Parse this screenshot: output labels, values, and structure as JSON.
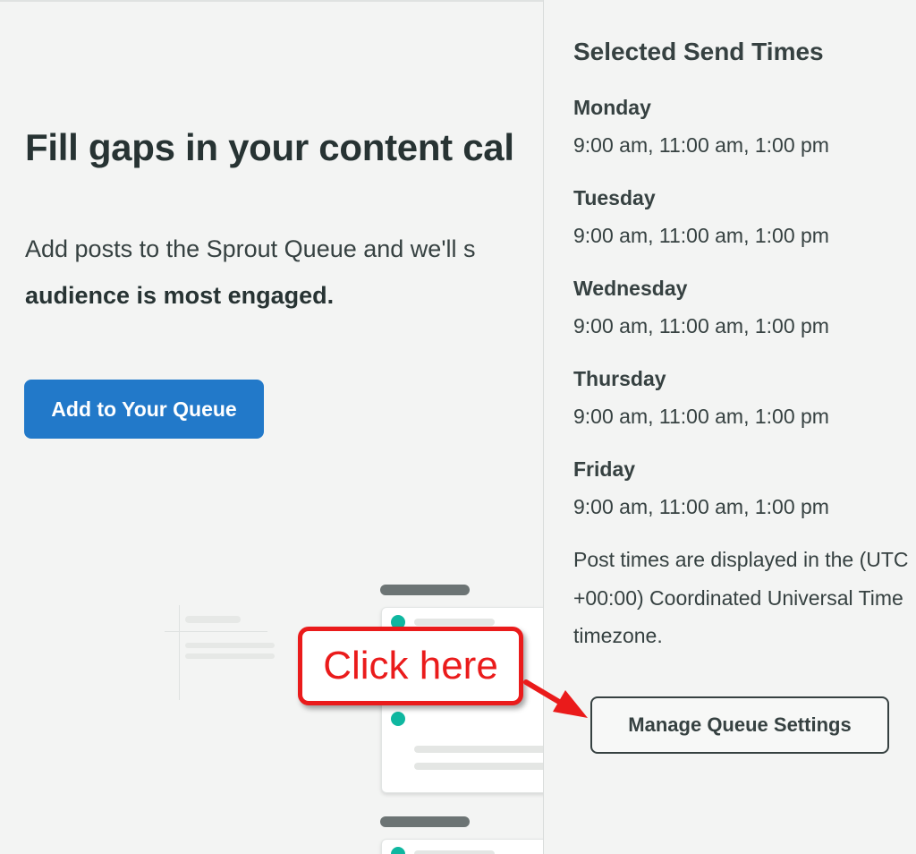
{
  "main": {
    "headline": "Fill gaps in your content cal",
    "description_line1": "Add posts to the Sprout Queue and we'll s",
    "description_line2": "audience is most engaged.",
    "add_button_label": "Add to Your Queue"
  },
  "callout": {
    "label": "Click here",
    "color": "#ea1b1b"
  },
  "panel": {
    "title": "Selected Send Times",
    "days": [
      {
        "name": "Monday",
        "times": "9:00 am, 11:00 am, 1:00 pm"
      },
      {
        "name": "Tuesday",
        "times": "9:00 am, 11:00 am, 1:00 pm"
      },
      {
        "name": "Wednesday",
        "times": "9:00 am, 11:00 am, 1:00 pm"
      },
      {
        "name": "Thursday",
        "times": "9:00 am, 11:00 am, 1:00 pm"
      },
      {
        "name": "Friday",
        "times": "9:00 am, 11:00 am, 1:00 pm"
      }
    ],
    "timezone_note": "Post times are displayed in the (UTC +00:00) Coordinated Universal Time timezone.",
    "manage_button_label": "Manage Queue Settings"
  },
  "colors": {
    "primary_button": "#2279c9",
    "accent_dot": "#0fb7a0",
    "text": "#364141"
  }
}
